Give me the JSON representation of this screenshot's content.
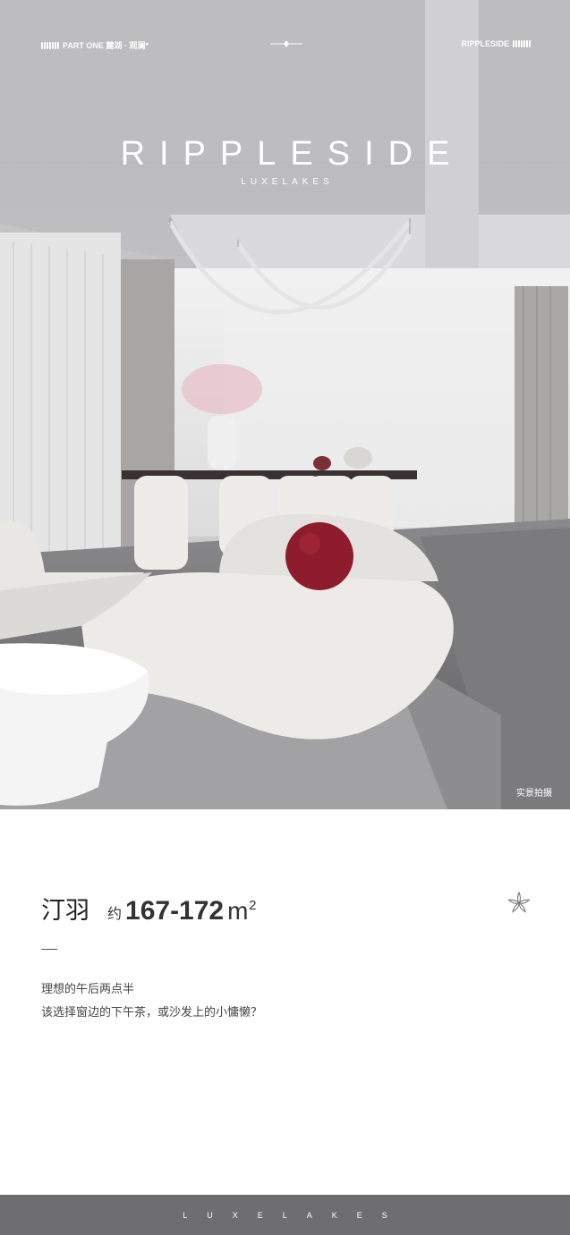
{
  "header": {
    "left_label": "PART ONE 麓湖 · 观澜*",
    "right_label": "RIPPLESIDE"
  },
  "brand": {
    "title": "RIPPLESIDE",
    "subtitle": "LUXELAKES"
  },
  "photo": {
    "caption": "实景拍摄"
  },
  "unit": {
    "name": "汀羽",
    "approx": "约",
    "area": "167-172",
    "unit": "m",
    "unit_sup": "2"
  },
  "description": {
    "line1": "理想的午后两点半",
    "line2": "该选择窗边的下午茶，或沙发上的小慵懒？"
  },
  "footer": {
    "letters": [
      "L",
      "U",
      "X",
      "E",
      "L",
      "A",
      "K",
      "E",
      "S"
    ]
  },
  "colors": {
    "footer_bg": "#6e6e70",
    "pillow": "#8e1c2c"
  }
}
